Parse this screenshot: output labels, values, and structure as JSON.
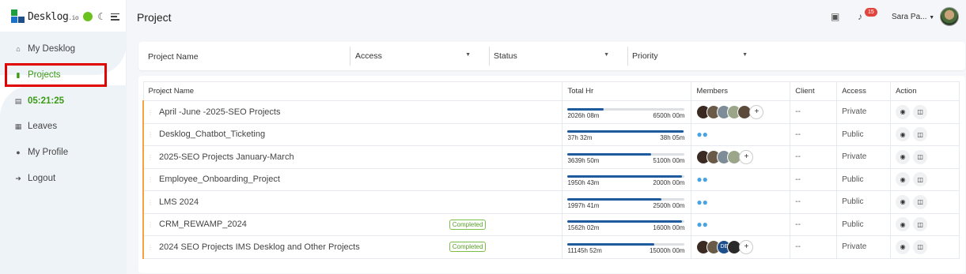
{
  "app": {
    "logo_text": "Desklog",
    "logo_suffix": ".io",
    "page_title": "Project",
    "notification_count": "15",
    "user_name": "Sara Pa...",
    "icons": {
      "moon": "moon-icon",
      "menu": "hamburger-icon",
      "screenshot": "camera-icon",
      "bell": "bell-icon"
    }
  },
  "sidebar": {
    "items": [
      {
        "label": "My Desklog",
        "icon": "home-icon"
      },
      {
        "label": "Projects",
        "icon": "book-icon"
      },
      {
        "label": "05:21:25",
        "icon": "timer-icon"
      },
      {
        "label": "Leaves",
        "icon": "calendar-icon"
      },
      {
        "label": "My Profile",
        "icon": "user-icon"
      },
      {
        "label": "Logout",
        "icon": "logout-icon"
      }
    ]
  },
  "filters": {
    "project_name_label": "Project Name",
    "access_label": "Access",
    "status_label": "Status",
    "priority_label": "Priority"
  },
  "table": {
    "columns": [
      "Project Name",
      "Total Hr",
      "Members",
      "Client",
      "Access",
      "Action"
    ],
    "rows": [
      {
        "name": "April -June -2025-SEO Projects",
        "status": "",
        "spent": "2026h 08m",
        "total": "6500h 00m",
        "progress": 0.31,
        "members": "avatars5",
        "client": "--",
        "access": "Private"
      },
      {
        "name": "Desklog_Chatbot_Ticketing",
        "status": "",
        "spent": "37h 32m",
        "total": "38h 05m",
        "progress": 0.99,
        "members": "group",
        "client": "--",
        "access": "Public"
      },
      {
        "name": "2025-SEO Projects January-March",
        "status": "",
        "spent": "3639h 50m",
        "total": "5100h 00m",
        "progress": 0.71,
        "members": "avatars4",
        "client": "--",
        "access": "Private"
      },
      {
        "name": "Employee_Onboarding_Project",
        "status": "",
        "spent": "1950h 43m",
        "total": "2000h 00m",
        "progress": 0.98,
        "members": "group",
        "client": "--",
        "access": "Public"
      },
      {
        "name": "LMS 2024",
        "status": "",
        "spent": "1997h 41m",
        "total": "2500h 00m",
        "progress": 0.8,
        "members": "group",
        "client": "--",
        "access": "Public"
      },
      {
        "name": "CRM_REWAMP_2024",
        "status": "Completed",
        "spent": "1562h 02m",
        "total": "1600h 00m",
        "progress": 0.98,
        "members": "group",
        "client": "--",
        "access": "Public"
      },
      {
        "name": "2024 SEO Projects IMS Desklog and Other Projects",
        "status": "Completed",
        "spent": "11145h 52m",
        "total": "15000h 00m",
        "progress": 0.74,
        "members": "avatarsDE",
        "client": "--",
        "access": "Private"
      }
    ]
  },
  "colors": {
    "brand_green": "#6bc21f",
    "progress_blue": "#1e5a9e",
    "row_marker": "#f4a340",
    "highlight": "#e00000"
  }
}
